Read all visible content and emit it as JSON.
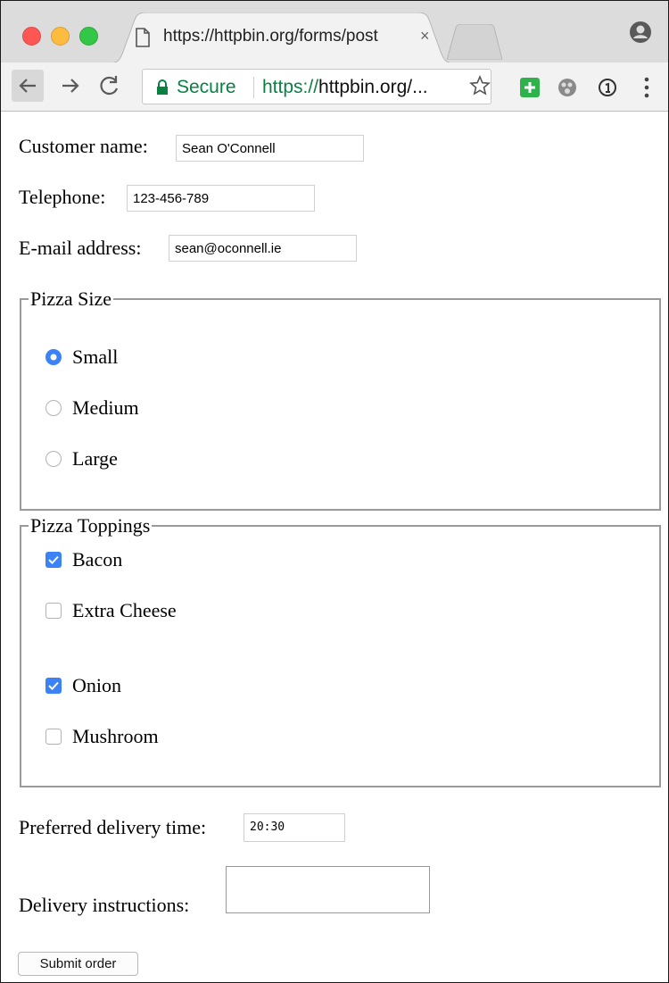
{
  "browser": {
    "tab_title": "https://httpbin.org/forms/post",
    "tab_close": "×",
    "omnibox": {
      "secure_label": "Secure",
      "url_scheme": "https://",
      "url_host": "httpbin.org/..."
    },
    "icons": {
      "back": "back-arrow-icon",
      "forward": "forward-arrow-icon",
      "reload": "reload-icon",
      "bookmark": "star-icon",
      "extensions": [
        "green-plus-icon",
        "grey-extension-icon",
        "info-circle-icon"
      ],
      "menu": "three-dots-menu-icon",
      "profile": "profile-icon"
    },
    "colors": {
      "secure_green": "#0b8043",
      "selected_blue": "#3b82f6"
    }
  },
  "form": {
    "customer_name": {
      "label": "Customer name:",
      "value": "Sean O'Connell"
    },
    "telephone": {
      "label": "Telephone:",
      "value": "123-456-789"
    },
    "email": {
      "label": "E-mail address:",
      "value": "sean@oconnell.ie"
    },
    "pizza_size": {
      "legend": "Pizza Size",
      "options": [
        {
          "label": "Small",
          "checked": true
        },
        {
          "label": "Medium",
          "checked": false
        },
        {
          "label": "Large",
          "checked": false
        }
      ]
    },
    "pizza_toppings": {
      "legend": "Pizza Toppings",
      "options": [
        {
          "label": "Bacon",
          "checked": true
        },
        {
          "label": "Extra Cheese",
          "checked": false
        },
        {
          "label": "Onion",
          "checked": true
        },
        {
          "label": "Mushroom",
          "checked": false
        }
      ]
    },
    "delivery_time": {
      "label": "Preferred delivery time:",
      "value": "20:30"
    },
    "delivery_instructions": {
      "label": "Delivery instructions:",
      "value": ""
    },
    "submit_label": "Submit order"
  }
}
